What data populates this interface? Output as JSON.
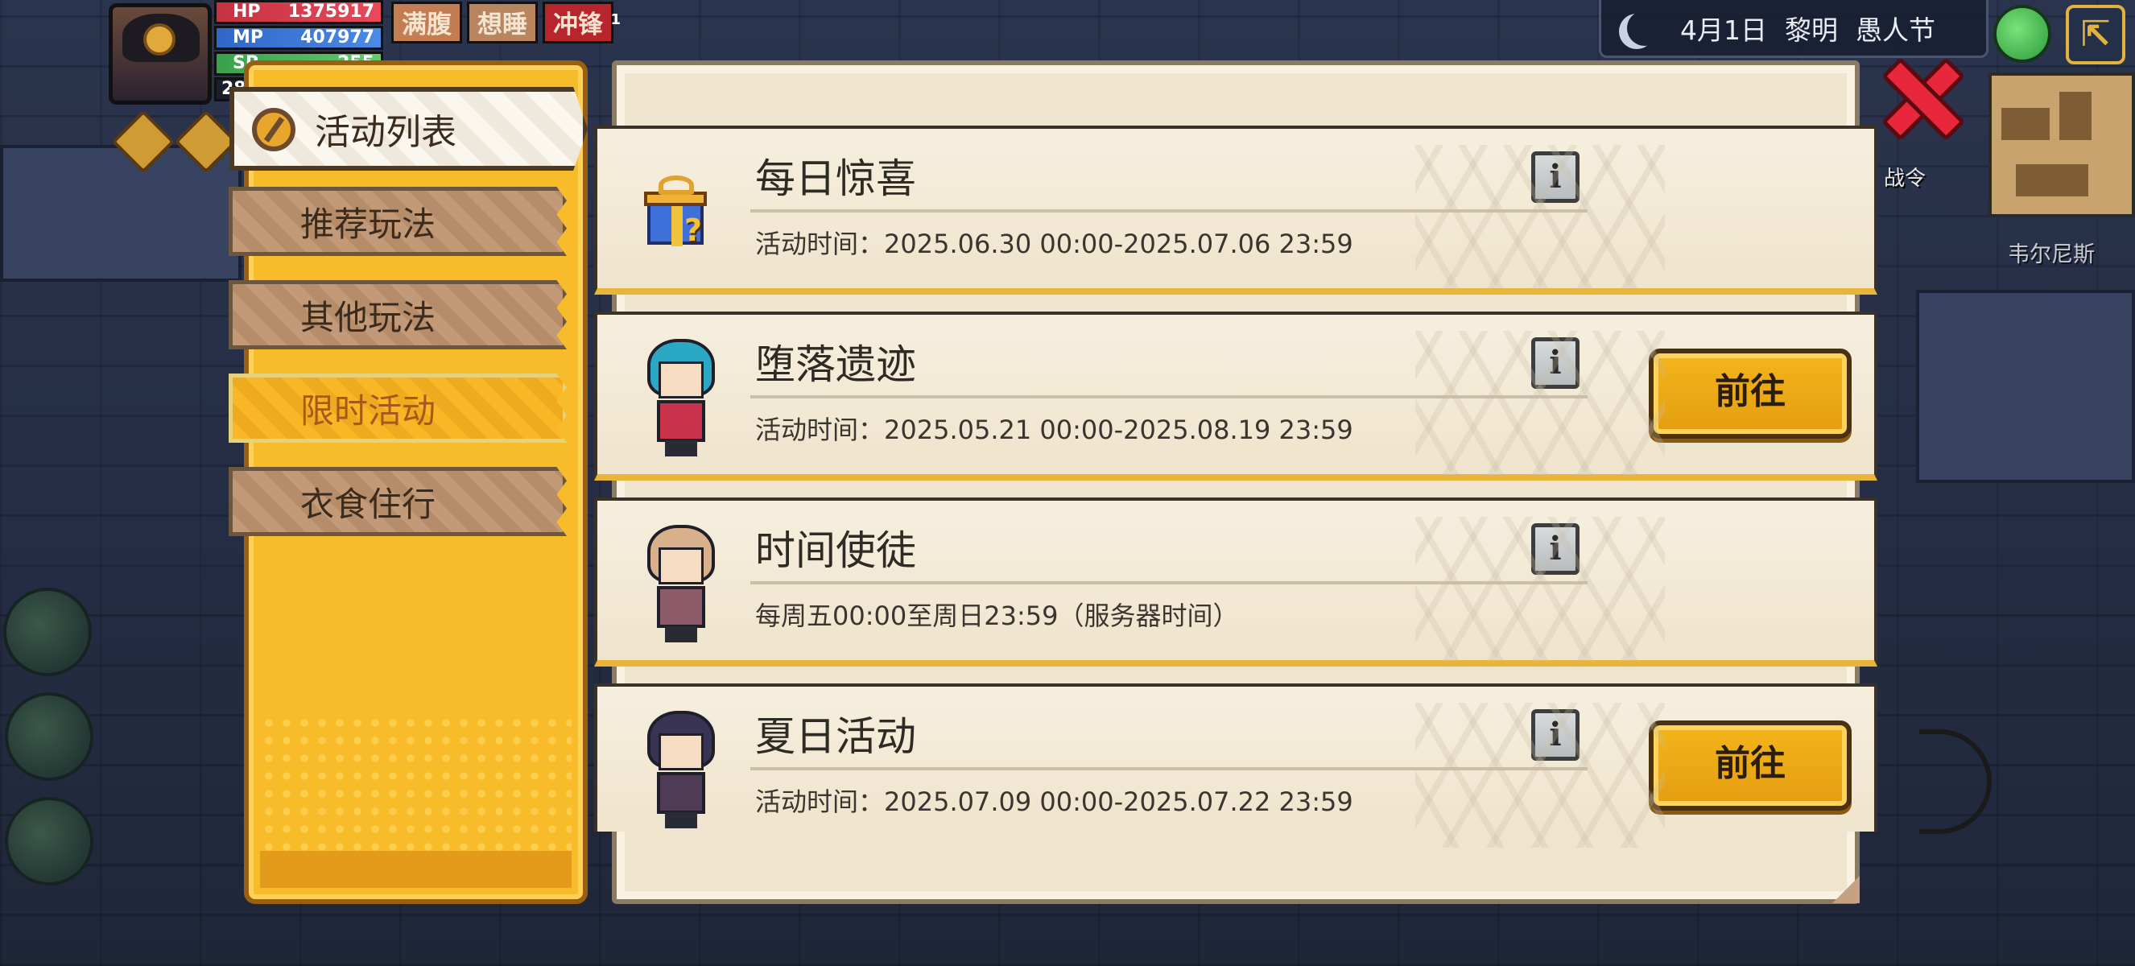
{
  "hud": {
    "hp_label": "HP",
    "hp_value": "1375917",
    "mp_label": "MP",
    "mp_value": "407977",
    "sp_label": "SP",
    "sp_value": "255",
    "status": [
      "满腹",
      "想睡",
      "冲锋"
    ],
    "charge_count": "1",
    "level": "28"
  },
  "topbar": {
    "date": "4月1日",
    "time_of_day": "黎明",
    "holiday": "愚人节"
  },
  "side_labels": {
    "battle_pass": "战令",
    "location": "韦尔尼斯"
  },
  "sidebar": {
    "header": "活动列表",
    "tabs": [
      {
        "label": "推荐玩法",
        "selected": false
      },
      {
        "label": "其他玩法",
        "selected": false
      },
      {
        "label": "限时活动",
        "selected": true
      },
      {
        "label": "衣食住行",
        "selected": false
      }
    ]
  },
  "activities": [
    {
      "title": "每日惊喜",
      "time": "活动时间：2025.06.30 00:00-2025.07.06 23:59",
      "icon": "gift-icon",
      "go_label": null
    },
    {
      "title": "堕落遗迹",
      "time": "活动时间：2025.05.21 00:00-2025.08.19 23:59",
      "icon": "character-icon",
      "go_label": "前往"
    },
    {
      "title": "时间使徒",
      "time": "每周五00:00至周日23:59（服务器时间）",
      "icon": "character-icon",
      "go_label": null
    },
    {
      "title": "夏日活动",
      "time": "活动时间：2025.07.09 00:00-2025.07.22 23:59",
      "icon": "character-icon",
      "go_label": "前往"
    }
  ],
  "info_glyph": "i",
  "colors": {
    "panel_gold": "#f8bb2a",
    "card_bg": "#f6efde",
    "button_gold": "#f3b51b",
    "close_red": "#e8283a"
  }
}
